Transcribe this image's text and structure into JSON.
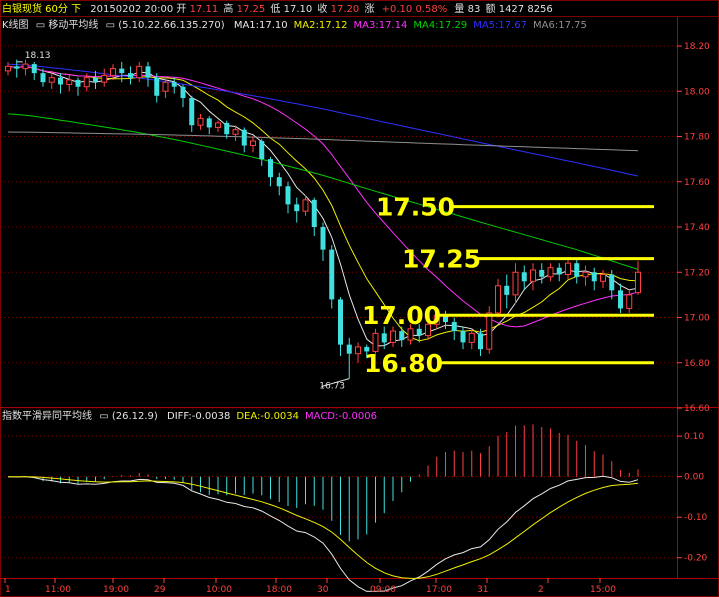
{
  "header": {
    "symbol": "白银现货 60分 下",
    "date": "20150202 20:00",
    "open_label": "开",
    "open": "17.11",
    "high_label": "高",
    "high": "17.25",
    "low_label": "低",
    "low": "17.10",
    "close_label": "收",
    "close": "17.20",
    "change_label": "涨",
    "change": "+0.10 0.58%",
    "volume_label": "量",
    "volume": "83",
    "amount_label": "额",
    "amount": "1427 8256"
  },
  "ma_legend": {
    "prefix": "K线图",
    "indicator": "移动平均线",
    "params": "(5.10.22.66.135.270)",
    "items": [
      {
        "label": "MA1:",
        "value": "17.10",
        "color": "#e8e8e8"
      },
      {
        "label": "MA2:",
        "value": "17.12",
        "color": "#f0f000"
      },
      {
        "label": "MA3:",
        "value": "17.14",
        "color": "#ff30ff"
      },
      {
        "label": "MA4:",
        "value": "17.29",
        "color": "#00d000"
      },
      {
        "label": "MA5:",
        "value": "17.67",
        "color": "#3030ff"
      },
      {
        "label": "MA6:",
        "value": "17.75",
        "color": "#909090"
      }
    ]
  },
  "macd_legend": {
    "indicator": "指数平滑异同平均线",
    "params": "(26.12.9)",
    "items": [
      {
        "label": "DIFF:",
        "value": "-0.0038",
        "color": "#e8e8e8"
      },
      {
        "label": "DEA:",
        "value": "-0.0034",
        "color": "#f0f000"
      },
      {
        "label": "MACD:",
        "value": "-0.0006",
        "color": "#ff30ff"
      }
    ]
  },
  "colors": {
    "up": "#ff4040",
    "down": "#40e0e0",
    "grid": "#7a0000",
    "axis_text": "#ff4040",
    "level": "#ffff00"
  },
  "chart_data": [
    {
      "type": "candlestick",
      "ylim": [
        16.6,
        18.2
      ],
      "yticks": [
        "18.20",
        "18.00",
        "17.80",
        "17.60",
        "17.40",
        "17.20",
        "17.00",
        "16.80",
        "16.60"
      ],
      "annotations": [
        {
          "text": "18.13",
          "value": 18.13
        },
        {
          "text": "16.73",
          "value": 16.73
        }
      ],
      "levels": [
        {
          "text": "17.50",
          "value": 17.49
        },
        {
          "text": "17.25",
          "value": 17.26
        },
        {
          "text": "17.00",
          "value": 17.01
        },
        {
          "text": "16.80",
          "value": 16.8
        }
      ],
      "candles": [
        [
          18.09,
          18.11,
          18.07,
          18.13
        ],
        [
          18.11,
          18.1,
          18.06,
          18.14
        ],
        [
          18.1,
          18.12,
          18.07,
          18.14
        ],
        [
          18.12,
          18.08,
          18.05,
          18.13
        ],
        [
          18.08,
          18.04,
          18.02,
          18.1
        ],
        [
          18.04,
          18.06,
          18.01,
          18.09
        ],
        [
          18.06,
          18.03,
          17.99,
          18.08
        ],
        [
          18.03,
          18.05,
          18.0,
          18.07
        ],
        [
          18.05,
          18.02,
          17.98,
          18.06
        ],
        [
          18.02,
          18.06,
          18.0,
          18.08
        ],
        [
          18.06,
          18.04,
          18.01,
          18.09
        ],
        [
          18.04,
          18.07,
          18.02,
          18.1
        ],
        [
          18.07,
          18.1,
          18.05,
          18.12
        ],
        [
          18.1,
          18.08,
          18.04,
          18.13
        ],
        [
          18.08,
          18.06,
          18.03,
          18.11
        ],
        [
          18.06,
          18.11,
          18.04,
          18.13
        ],
        [
          18.11,
          18.06,
          18.02,
          18.13
        ],
        [
          18.06,
          17.98,
          17.95,
          18.08
        ],
        [
          18.0,
          18.04,
          17.97,
          18.06
        ],
        [
          18.04,
          18.02,
          17.99,
          18.06
        ],
        [
          18.02,
          17.97,
          17.93,
          18.03
        ],
        [
          17.97,
          17.85,
          17.82,
          17.98
        ],
        [
          17.85,
          17.88,
          17.83,
          17.9
        ],
        [
          17.88,
          17.84,
          17.81,
          17.89
        ],
        [
          17.84,
          17.86,
          17.82,
          17.87
        ],
        [
          17.86,
          17.81,
          17.79,
          17.87
        ],
        [
          17.81,
          17.83,
          17.78,
          17.85
        ],
        [
          17.83,
          17.76,
          17.73,
          17.84
        ],
        [
          17.76,
          17.78,
          17.73,
          17.8
        ],
        [
          17.78,
          17.7,
          17.67,
          17.79
        ],
        [
          17.7,
          17.62,
          17.58,
          17.71
        ],
        [
          17.62,
          17.58,
          17.54,
          17.64
        ],
        [
          17.58,
          17.5,
          17.46,
          17.6
        ],
        [
          17.5,
          17.47,
          17.42,
          17.53
        ],
        [
          17.47,
          17.52,
          17.45,
          17.54
        ],
        [
          17.52,
          17.4,
          17.36,
          17.53
        ],
        [
          17.4,
          17.3,
          17.25,
          17.42
        ],
        [
          17.3,
          17.08,
          17.04,
          17.32
        ],
        [
          17.08,
          16.88,
          16.83,
          17.09
        ],
        [
          16.88,
          16.84,
          16.73,
          16.91
        ],
        [
          16.84,
          16.87,
          16.8,
          16.89
        ],
        [
          16.87,
          16.85,
          16.82,
          16.88
        ],
        [
          16.85,
          16.93,
          16.84,
          16.95
        ],
        [
          16.93,
          16.89,
          16.86,
          16.96
        ],
        [
          16.89,
          16.94,
          16.87,
          16.96
        ],
        [
          16.94,
          16.9,
          16.87,
          16.96
        ],
        [
          16.9,
          16.95,
          16.88,
          16.97
        ],
        [
          16.95,
          16.92,
          16.89,
          16.97
        ],
        [
          16.92,
          16.97,
          16.9,
          16.99
        ],
        [
          16.97,
          17.01,
          16.95,
          17.04
        ],
        [
          17.01,
          16.98,
          16.95,
          17.03
        ],
        [
          16.98,
          16.94,
          16.9,
          17.0
        ],
        [
          16.94,
          16.89,
          16.86,
          16.96
        ],
        [
          16.89,
          16.93,
          16.86,
          16.95
        ],
        [
          16.93,
          16.86,
          16.83,
          16.95
        ],
        [
          16.86,
          17.02,
          16.84,
          17.05
        ],
        [
          17.02,
          17.14,
          17.0,
          17.17
        ],
        [
          17.14,
          17.1,
          17.04,
          17.19
        ],
        [
          17.1,
          17.2,
          17.06,
          17.24
        ],
        [
          17.2,
          17.16,
          17.12,
          17.23
        ],
        [
          17.16,
          17.21,
          17.12,
          17.24
        ],
        [
          17.21,
          17.18,
          17.15,
          17.24
        ],
        [
          17.18,
          17.22,
          17.16,
          17.24
        ],
        [
          17.22,
          17.19,
          17.16,
          17.24
        ],
        [
          17.19,
          17.24,
          17.17,
          17.26
        ],
        [
          17.24,
          17.18,
          17.15,
          17.26
        ],
        [
          17.18,
          17.2,
          17.14,
          17.23
        ],
        [
          17.2,
          17.16,
          17.12,
          17.22
        ],
        [
          17.16,
          17.19,
          17.13,
          17.21
        ],
        [
          17.19,
          17.12,
          17.08,
          17.21
        ],
        [
          17.12,
          17.04,
          17.02,
          17.15
        ],
        [
          17.04,
          17.1,
          17.02,
          17.12
        ],
        [
          17.11,
          17.2,
          17.1,
          17.25
        ]
      ]
    },
    {
      "type": "bar+line",
      "ylim": [
        -0.25,
        0.13
      ],
      "yticks": [
        "0.10",
        "0.00",
        "-0.10",
        "-0.20"
      ],
      "x_labels": [
        "1",
        "11:00",
        "19:00",
        "29",
        "10:00",
        "18:00",
        "30",
        "09:00",
        "17:00",
        "31",
        "2",
        "15:00"
      ]
    }
  ]
}
